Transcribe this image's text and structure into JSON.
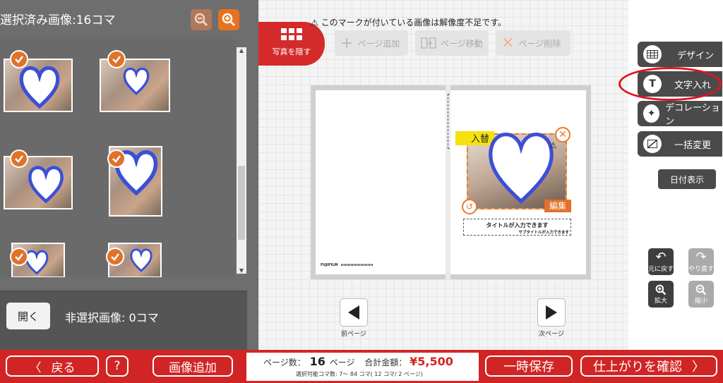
{
  "left_panel": {
    "title": "選択済み画像:16コマ",
    "unselected_label": "非選択画像: 0コマ",
    "open_button": "開く"
  },
  "toolbar": {
    "hide_photos": "写真を隠す",
    "add_page": "ページ追加",
    "move_page": "ページ移動",
    "delete_page": "ページ削除"
  },
  "warning": "このマークが付いている画像は解像度不足です。",
  "page": {
    "swap_label": "入替",
    "edit_label": "編集",
    "title_placeholder": "タイトルが入力できます",
    "subtitle_placeholder": "サブタイトルが入力できます",
    "brand": "FUJIFILM"
  },
  "nav": {
    "prev": "前ページ",
    "next": "次ページ"
  },
  "right_panel": {
    "design": "デザイン",
    "text_input": "文字入れ",
    "decoration": "デコレーション",
    "bulk_change": "一括変更",
    "date_display": "日付表示",
    "undo": "元に戻す",
    "redo": "やり直す",
    "zoom_in": "拡大",
    "zoom_out": "縮小"
  },
  "bottom_bar": {
    "back": "戻る",
    "help": "?",
    "add_image": "画像追加",
    "page_count_label": "ページ数：",
    "page_count": "16",
    "page_unit": "ページ",
    "total_label": "合計金額：",
    "total": "¥5,500",
    "selectable_info": "選択可能コマ数: 7～ 84 コマ( 12 コマ/ 2 ページ)",
    "temp_save": "一時保存",
    "confirm": "仕上がりを確認"
  },
  "colors": {
    "accent_red": "#d12525",
    "accent_orange": "#e0722a",
    "highlight_circle": "#e0141e"
  }
}
